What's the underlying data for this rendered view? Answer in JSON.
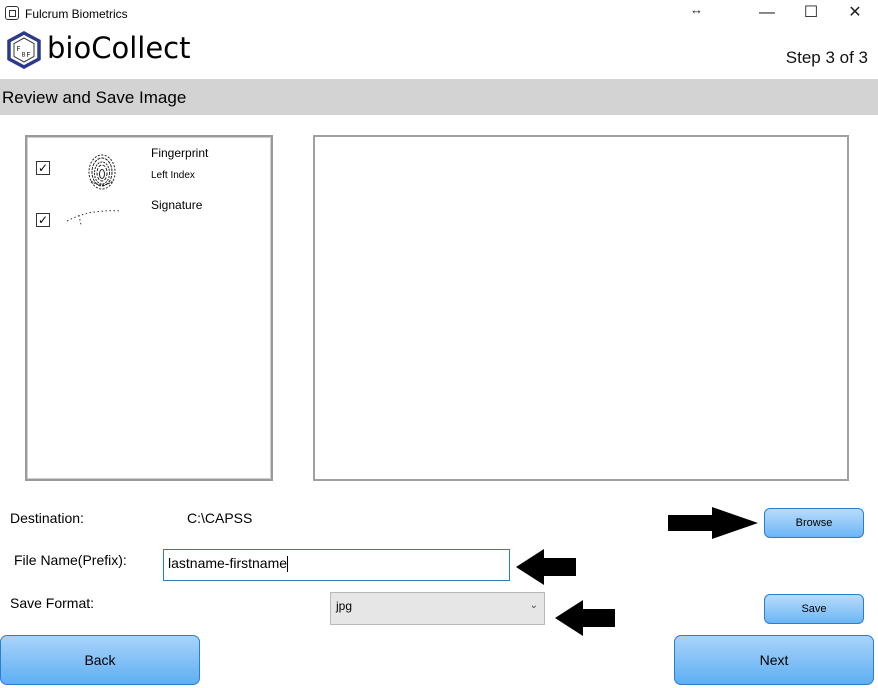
{
  "window": {
    "title": "Fulcrum Biometrics",
    "controls": {
      "resize": "↔",
      "minimize": "—",
      "maximize": "☐",
      "close": "✕"
    }
  },
  "header": {
    "brand": "bioCollect",
    "step": "Step 3 of 3"
  },
  "section": {
    "title": "Review and Save Image"
  },
  "capture_list": [
    {
      "label": "Fingerprint",
      "sublabel": "Left Index",
      "checked": true,
      "checkmark": "✓",
      "icon": "fingerprint-thumbnail"
    },
    {
      "label": "Signature",
      "sublabel": "",
      "checked": true,
      "checkmark": "✓",
      "icon": "signature-thumbnail"
    }
  ],
  "form": {
    "destination_label": "Destination:",
    "destination_value": "C:\\CAPSS",
    "file_name_label": "File Name(Prefix):",
    "file_name_value": "lastname-firstname",
    "save_format_label": "Save Format:",
    "save_format_value": "jpg",
    "dropdown_icon": "⌄"
  },
  "buttons": {
    "browse": "Browse",
    "save": "Save",
    "back": "Back",
    "next": "Next"
  },
  "colors": {
    "section_bar": "#d3d3d3",
    "button_gradient_top": "#b9dcfb",
    "button_gradient_bottom": "#6bb6f5",
    "button_border": "#2a7ecf",
    "input_border": "#2d7fb8",
    "annotation_arrow": "#000000"
  }
}
